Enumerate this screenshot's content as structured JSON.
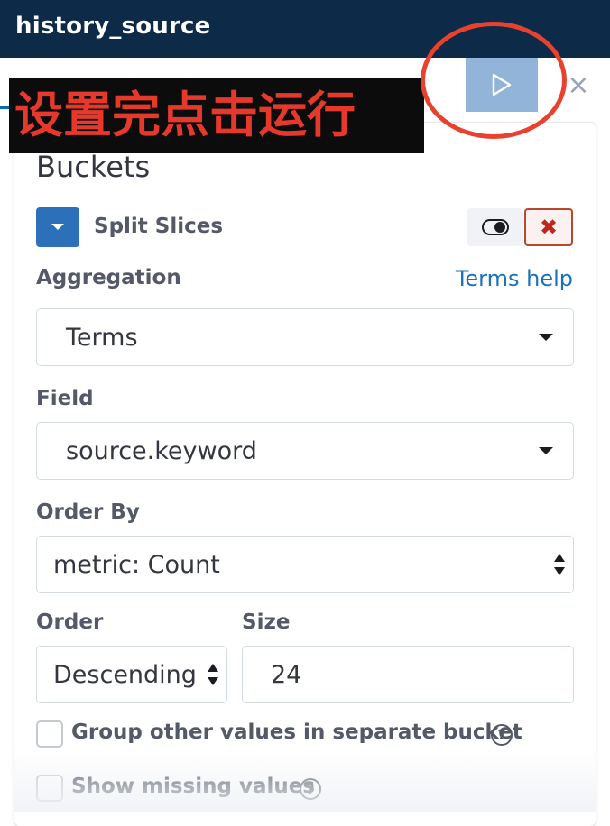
{
  "header": {
    "title": "history_source"
  },
  "toolbar": {
    "run_icon": "play-icon",
    "close_icon": "close-icon",
    "close_glyph": "×"
  },
  "annotation": {
    "text": "设置完点击运行",
    "circle_color": "#e8412d",
    "text_color": "#e7392b"
  },
  "buckets": {
    "heading": "Buckets",
    "item": {
      "label": "Split Slices",
      "toggle_icon": "toggle-switch-icon",
      "remove_icon": "cross-icon",
      "remove_glyph": "✖"
    }
  },
  "aggregation": {
    "label": "Aggregation",
    "help_link": "Terms help",
    "value": "Terms"
  },
  "field": {
    "label": "Field",
    "value": "source.keyword"
  },
  "order_by": {
    "label": "Order By",
    "value": "metric: Count"
  },
  "order": {
    "label": "Order",
    "value": "Descending"
  },
  "size": {
    "label": "Size",
    "value": "24"
  },
  "options": {
    "group_other": {
      "label": "Group other values in separate bucket",
      "checked": false
    },
    "show_missing": {
      "label": "Show missing values",
      "checked": false
    },
    "help_glyph": "?"
  },
  "colors": {
    "header_bg": "#0d2a48",
    "accent": "#2b70b8",
    "run_button": "#93b4d9",
    "danger": "#bd271e",
    "link": "#1a72bd"
  }
}
